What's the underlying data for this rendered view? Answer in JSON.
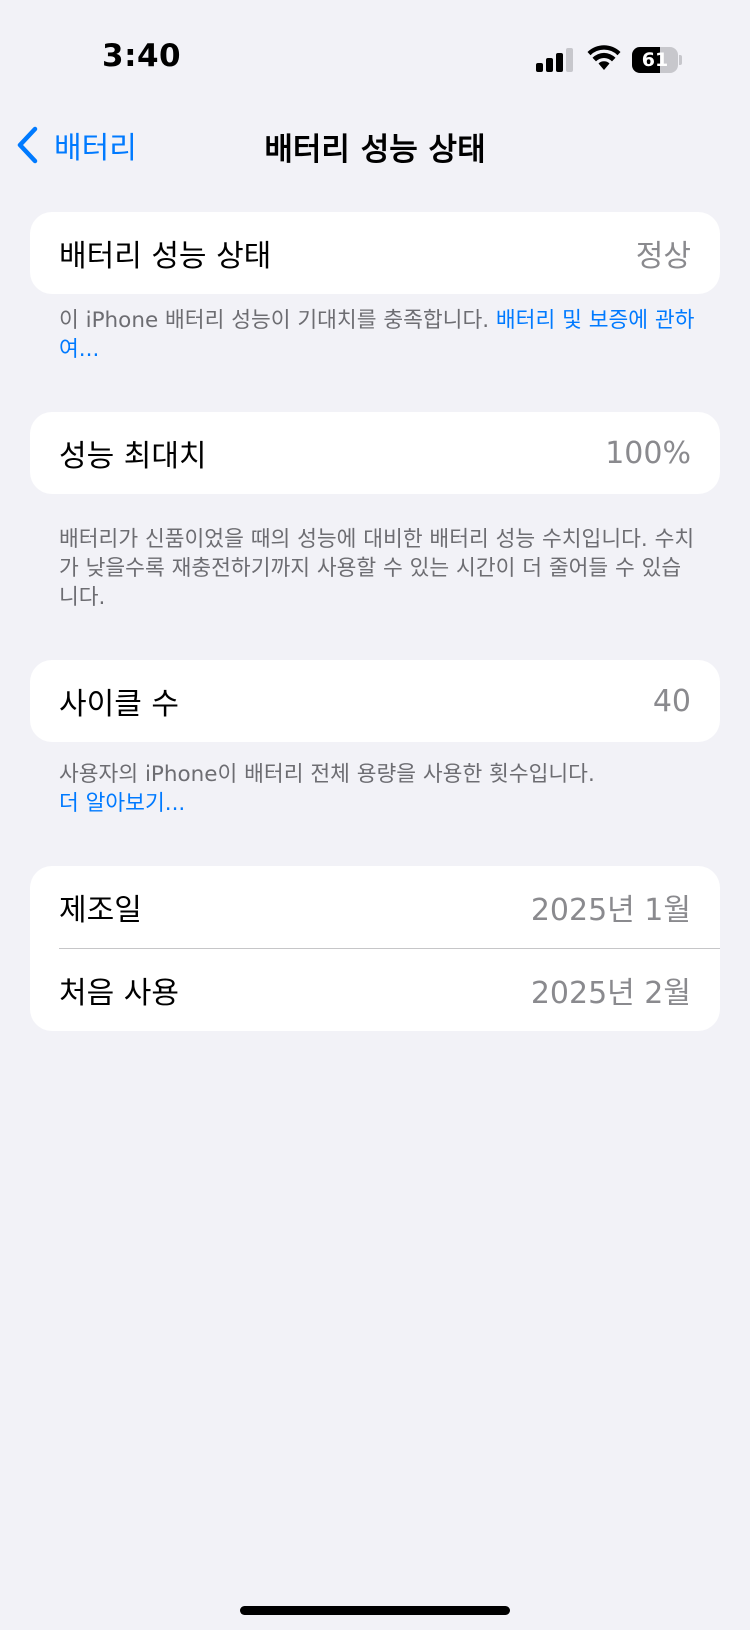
{
  "status_bar": {
    "time": "3:40",
    "battery_level": "61",
    "battery_fraction": 0.61,
    "signal_bars": 4,
    "signal_active_bars": 3
  },
  "nav": {
    "back_label": "배터리",
    "title": "배터리 성능 상태"
  },
  "sections": {
    "health": {
      "label": "배터리 성능 상태",
      "value": "정상",
      "footnote_text": "이 iPhone 배터리 성능이 기대치를 충족합니다. ",
      "footnote_link": "배터리 및 보증에 관하여..."
    },
    "max_capacity": {
      "label": "성능 최대치",
      "value": "100%",
      "footnote_text": "배터리가 신품이었을 때의 성능에 대비한 배터리 성능 수치입니다. 수치가 낮을수록 재충전하기까지 사용할 수 있는 시간이 더 줄어들 수 있습니다."
    },
    "cycle_count": {
      "label": "사이클 수",
      "value": "40",
      "footnote_text": "사용자의 iPhone이 배터리 전체 용량을 사용한 횟수입니다.",
      "footnote_link": "더 알아보기..."
    },
    "dates": {
      "manufactured_label": "제조일",
      "manufactured_value": "2025년 1월",
      "first_use_label": "처음 사용",
      "first_use_value": "2025년 2월"
    }
  },
  "colors": {
    "background": "#f2f2f7",
    "card": "#ffffff",
    "accent": "#007aff",
    "secondary_text": "#8a8a8e",
    "footnote_text": "#6d6d72"
  }
}
